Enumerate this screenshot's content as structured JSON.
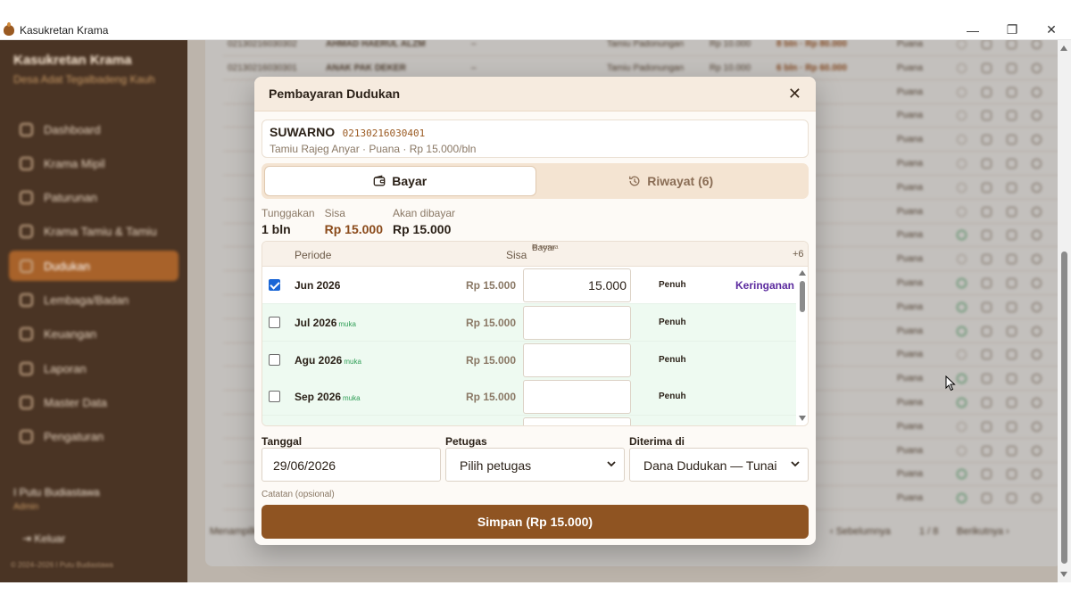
{
  "window": {
    "title": "Kasukretan Krama",
    "controls": {
      "minimize": "—",
      "restore": "❐",
      "close": "✕"
    }
  },
  "sidebar": {
    "brand": "Kasukretan Krama",
    "subtitle": "Desa Adat Tegalbadeng Kauh",
    "items": [
      {
        "label": "Dashboard",
        "active": false
      },
      {
        "label": "Krama Mipil",
        "active": false
      },
      {
        "label": "Paturunan",
        "active": false
      },
      {
        "label": "Krama Tamiu & Tamiu",
        "active": false
      },
      {
        "label": "Dudukan",
        "active": true
      },
      {
        "label": "Lembaga/Badan",
        "active": false
      },
      {
        "label": "Keuangan",
        "active": false
      },
      {
        "label": "Laporan",
        "active": false
      },
      {
        "label": "Master Data",
        "active": false
      },
      {
        "label": "Pengaturan",
        "active": false
      }
    ],
    "user_name": "I Putu Budiastawa",
    "user_role": "Admin",
    "logout_label": "Keluar",
    "copyright": "© 2024–2026 I Putu Budiastawa"
  },
  "background_rows": [
    {
      "id": "02130216030302",
      "name": "AHMAD HAERUL ALZM",
      "dash": "–",
      "type": "Tamiu Padonungan",
      "rate": "Rp 10.000",
      "due": "8 bln · Rp 80.000",
      "status": "Puana",
      "green": false
    },
    {
      "id": "02130216030301",
      "name": "ANAK PAK DEKER",
      "dash": "–",
      "type": "Tamiu Padonungan",
      "rate": "Rp 10.000",
      "due": "6 bln · Rp 60.000",
      "status": "Puana",
      "green": false
    },
    {
      "id": "",
      "name": "",
      "dash": "",
      "type": "",
      "rate": "",
      "due": "",
      "status": "Puana",
      "green": false
    },
    {
      "id": "",
      "name": "",
      "dash": "",
      "type": "",
      "rate": "",
      "due": "",
      "status": "Puana",
      "green": false
    },
    {
      "id": "",
      "name": "",
      "dash": "",
      "type": "",
      "rate": "",
      "due": "",
      "status": "Puana",
      "green": false
    },
    {
      "id": "",
      "name": "",
      "dash": "",
      "type": "",
      "rate": "",
      "due": "",
      "status": "Puana",
      "green": false
    },
    {
      "id": "",
      "name": "",
      "dash": "",
      "type": "",
      "rate": "",
      "due": "",
      "status": "Puana",
      "green": false
    },
    {
      "id": "",
      "name": "",
      "dash": "",
      "type": "",
      "rate": "",
      "due": "",
      "status": "Puana",
      "green": false
    },
    {
      "id": "",
      "name": "",
      "dash": "",
      "type": "",
      "rate": "",
      "due": "",
      "status": "Puana",
      "green": true
    },
    {
      "id": "",
      "name": "",
      "dash": "",
      "type": "",
      "rate": "",
      "due": "",
      "status": "Puana",
      "green": false
    },
    {
      "id": "",
      "name": "",
      "dash": "",
      "type": "",
      "rate": "",
      "due": "",
      "status": "Puana",
      "green": true
    },
    {
      "id": "",
      "name": "",
      "dash": "",
      "type": "",
      "rate": "",
      "due": "",
      "status": "Puana",
      "green": true
    },
    {
      "id": "",
      "name": "",
      "dash": "",
      "type": "",
      "rate": "",
      "due": "",
      "status": "Puana",
      "green": true
    },
    {
      "id": "",
      "name": "",
      "dash": "",
      "type": "",
      "rate": "",
      "due": "",
      "status": "Puana",
      "green": false
    },
    {
      "id": "",
      "name": "",
      "dash": "",
      "type": "",
      "rate": "",
      "due": "",
      "status": "Puana",
      "green": true
    },
    {
      "id": "",
      "name": "",
      "dash": "",
      "type": "",
      "rate": "",
      "due": "",
      "status": "Puana",
      "green": true
    },
    {
      "id": "",
      "name": "",
      "dash": "",
      "type": "",
      "rate": "",
      "due": "",
      "status": "Puana",
      "green": false
    },
    {
      "id": "",
      "name": "",
      "dash": "",
      "type": "",
      "rate": "",
      "due": "",
      "status": "Puana",
      "green": false
    },
    {
      "id": "",
      "name": "",
      "dash": "",
      "type": "",
      "rate": "",
      "due": "",
      "status": "Puana",
      "green": true
    },
    {
      "id": "",
      "name": "",
      "dash": "",
      "type": "",
      "rate": "",
      "due": "",
      "status": "Puana",
      "green": true
    }
  ],
  "background_pager": {
    "showing": "Menampilkan",
    "prev": "‹ Sebelumnya",
    "page": "1 / 8",
    "next": "Berikutnya ›"
  },
  "modal": {
    "title": "Pembayaran Dudukan",
    "close": "✕",
    "member": {
      "name": "SUWARNO",
      "id": "02130216030401",
      "info": "Tamiu Rajeg Anyar · Puana · Rp 15.000/bln"
    },
    "tabs": [
      {
        "label": "Bayar",
        "active": true,
        "icon": "wallet-icon"
      },
      {
        "label": "Riwayat (6)",
        "active": false,
        "icon": "history-icon"
      }
    ],
    "summary": [
      {
        "label": "Tunggakan",
        "value": "1 bln",
        "brown": false
      },
      {
        "label": "Sisa",
        "value": "Rp 15.000",
        "brown": true
      },
      {
        "label": "Akan dibayar",
        "value": "Rp 15.000",
        "brown": false
      }
    ],
    "table": {
      "headers": {
        "periode": "Periode",
        "sisa": "Sisa",
        "bayar": "Bayar",
        "bayar_sub": "isi semua",
        "more": "+6"
      },
      "rows": [
        {
          "periode": "Jun 2026",
          "muka": "",
          "sisa": "Rp 15.000",
          "bayar": "15.000",
          "penuh": "Penuh",
          "action": "Keringanan",
          "checked": true
        },
        {
          "periode": "Jul 2026",
          "muka": "muka",
          "sisa": "Rp 15.000",
          "bayar": "",
          "penuh": "Penuh",
          "action": "",
          "checked": false
        },
        {
          "periode": "Agu 2026",
          "muka": "muka",
          "sisa": "Rp 15.000",
          "bayar": "",
          "penuh": "Penuh",
          "action": "",
          "checked": false
        },
        {
          "periode": "Sep 2026",
          "muka": "muka",
          "sisa": "Rp 15.000",
          "bayar": "",
          "penuh": "Penuh",
          "action": "",
          "checked": false
        }
      ]
    },
    "form": {
      "tanggal_label": "Tanggal",
      "tanggal_value": "29/06/2026",
      "petugas_label": "Petugas",
      "petugas_value": "Pilih petugas",
      "diterima_label": "Diterima di",
      "diterima_value": "Dana Dudukan — Tunai",
      "catatan_label": "Catatan (opsional)"
    },
    "save_label": "Simpan (Rp 15.000)"
  },
  "colors": {
    "accent": "#8f5422",
    "sidebar": "#4a3424",
    "active_nav": "#a8622a",
    "advance_row": "#eefaf1",
    "keringanan": "#5b2a9e"
  }
}
